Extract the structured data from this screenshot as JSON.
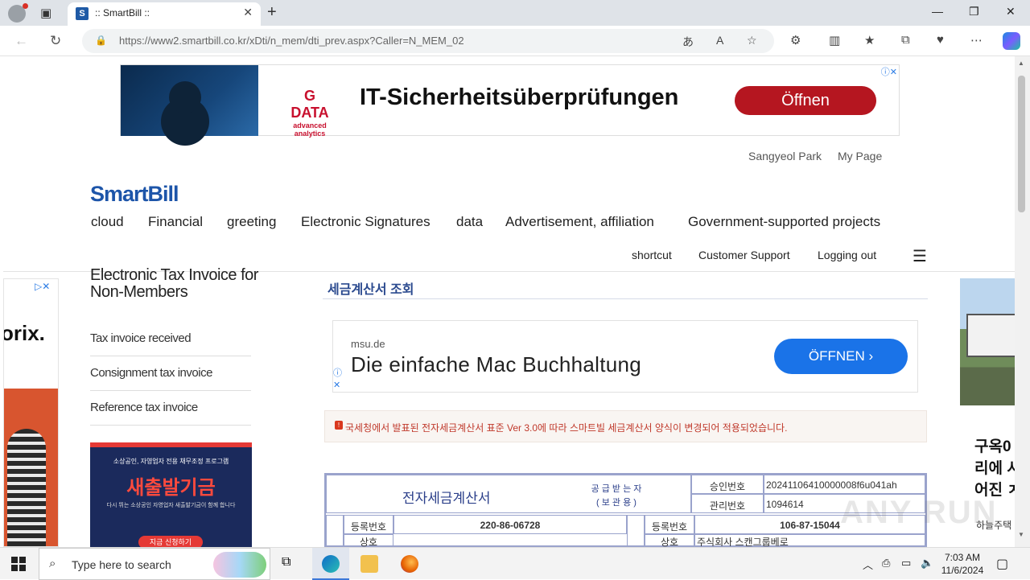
{
  "browser": {
    "tab_title": ":: SmartBill ::",
    "tab_favicon": "S",
    "url": "https://www2.smartbill.co.kr/xDti/n_mem/dti_prev.aspx?Caller=N_MEM_02"
  },
  "top_ad": {
    "brand": "G DATA",
    "brand_sub": "advanced analytics",
    "headline": "IT-Sicherheitsüberprüfungen",
    "button": "Öffnen"
  },
  "header": {
    "user_name": "Sangyeol Park",
    "my_page": "My Page",
    "logo": "SmartBill",
    "menu": [
      "cloud",
      "Financial",
      "greeting",
      "Electronic Signatures",
      "data",
      "Advertisement, affiliation",
      "Government-supported projects"
    ],
    "sub_links": [
      "shortcut",
      "Customer Support",
      "Logging out"
    ]
  },
  "left_ad": {
    "text": "orix."
  },
  "sidebar": {
    "title": "Electronic Tax Invoice for Non-Members",
    "links": [
      "Tax invoice received",
      "Consignment tax invoice",
      "Reference tax invoice"
    ],
    "banner": {
      "small": "소상공인, 자영업자 전용 채무조정 프로그램",
      "big": "새출발기금",
      "desc": "다시 뛰는 소상공인 자영업자 새출발기금이 함께 합니다",
      "cta": "지금 신청하기"
    }
  },
  "main": {
    "title": "세금계산서 조회",
    "ad": {
      "domain": "msu.de",
      "headline": "Die einfache Mac Buchhaltung",
      "button": "ÖFFNEN ›"
    },
    "notice": "국세청에서 발표된 전자세금계산서 표준 Ver 3.0에 따라 스마트빌 세금계산서 양식이 변경되어 적용되었습니다.",
    "invoice": {
      "title": "전자세금계산서",
      "receiver_label": "공 급 받 는 자",
      "receiver_sub": "( 보 관 용 )",
      "approval_label": "승인번호",
      "approval_no": "20241106410000008f6u041ah",
      "mgmt_label": "관리번호",
      "mgmt_no": "1094614",
      "reg_label": "등록번호",
      "supplier_reg_no": "220-86-06728",
      "buyer_reg_no": "106-87-15044",
      "company_label": "상호",
      "buyer_company": "주식회사 스캔그룹베로"
    }
  },
  "right_ad": {
    "text_lines": [
      "구옥0",
      "리에 시",
      "어진 ㅈ"
    ],
    "small": "하늘주택"
  },
  "watermark": "ANY RUN",
  "taskbar": {
    "search_placeholder": "Type here to search",
    "time": "7:03 AM",
    "date": "11/6/2024"
  }
}
